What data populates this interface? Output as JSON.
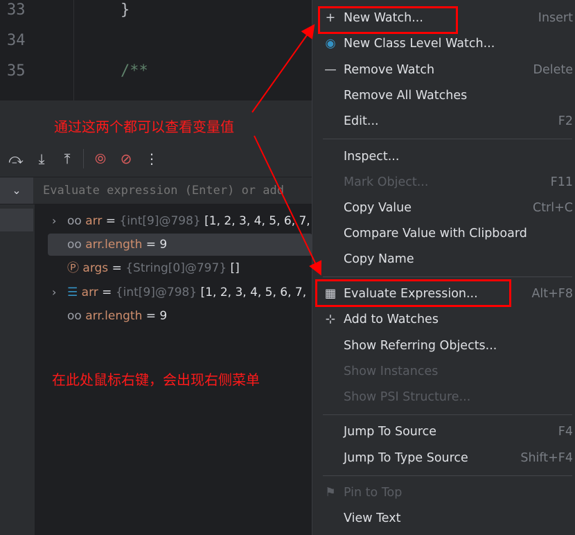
{
  "editor": {
    "lines": [
      {
        "num": "33",
        "code": "}"
      },
      {
        "num": "34",
        "code": ""
      },
      {
        "num": "35",
        "code": "/**"
      }
    ]
  },
  "debug": {
    "toolbar_icons": [
      "step-over-icon",
      "step-into-icon",
      "step-out-icon",
      "view-breakpoints-icon",
      "mute-breakpoints-icon",
      "more-icon"
    ],
    "eval_placeholder": "Evaluate expression (Enter) or add",
    "variables": [
      {
        "icon": "watch-icon",
        "name": "arr",
        "eq": " = ",
        "type": "{int[9]@798}",
        "value": " [1, 2, 3, 4, 5, 6, 7,",
        "expandable": true
      },
      {
        "icon": "watch-icon",
        "name": "arr.length",
        "eq": " = ",
        "type": "",
        "value": "9",
        "expandable": false,
        "selected": true
      },
      {
        "icon": "parameter-icon",
        "name": "args",
        "eq": " = ",
        "type": "{String[0]@797}",
        "value": " []",
        "expandable": false
      },
      {
        "icon": "array-icon",
        "name": "arr",
        "eq": " = ",
        "type": "{int[9]@798}",
        "value": " [1, 2, 3, 4, 5, 6, 7,",
        "expandable": true
      },
      {
        "icon": "watch-icon",
        "name": "arr.length",
        "eq": " = ",
        "type": "",
        "value": "9",
        "expandable": false
      }
    ]
  },
  "annotations": {
    "top": "通过这两个都可以查看变量值",
    "bottom": "在此处鼠标右键，会出现右侧菜单",
    "color": "#ff0000"
  },
  "menu": {
    "items": [
      {
        "label": "New Watch...",
        "shortcut": "Insert",
        "icon": "plus-icon"
      },
      {
        "label": "New Class Level Watch...",
        "shortcut": "",
        "icon": "class-watch-icon"
      },
      {
        "label": "Remove Watch",
        "shortcut": "Delete",
        "icon": "minus-icon"
      },
      {
        "label": "Remove All Watches",
        "shortcut": ""
      },
      {
        "label": "Edit...",
        "shortcut": "F2"
      },
      {
        "label": "Inspect...",
        "shortcut": ""
      },
      {
        "label": "Mark Object...",
        "shortcut": "F11",
        "disabled": true
      },
      {
        "label": "Copy Value",
        "shortcut": "Ctrl+C"
      },
      {
        "label": "Compare Value with Clipboard",
        "shortcut": ""
      },
      {
        "label": "Copy Name",
        "shortcut": ""
      },
      {
        "label": "Evaluate Expression...",
        "shortcut": "Alt+F8",
        "icon": "calculator-icon"
      },
      {
        "label": "Add to Watches",
        "shortcut": "",
        "icon": "add-watch-icon"
      },
      {
        "label": "Show Referring Objects...",
        "shortcut": ""
      },
      {
        "label": "Show Instances",
        "shortcut": "",
        "disabled": true
      },
      {
        "label": "Show PSI Structure...",
        "shortcut": "",
        "disabled": true
      },
      {
        "label": "Jump To Source",
        "shortcut": "F4"
      },
      {
        "label": "Jump To Type Source",
        "shortcut": "Shift+F4"
      },
      {
        "label": "Pin to Top",
        "shortcut": "",
        "disabled": true,
        "icon": "pin-icon"
      },
      {
        "label": "View Text",
        "shortcut": ""
      }
    ]
  }
}
